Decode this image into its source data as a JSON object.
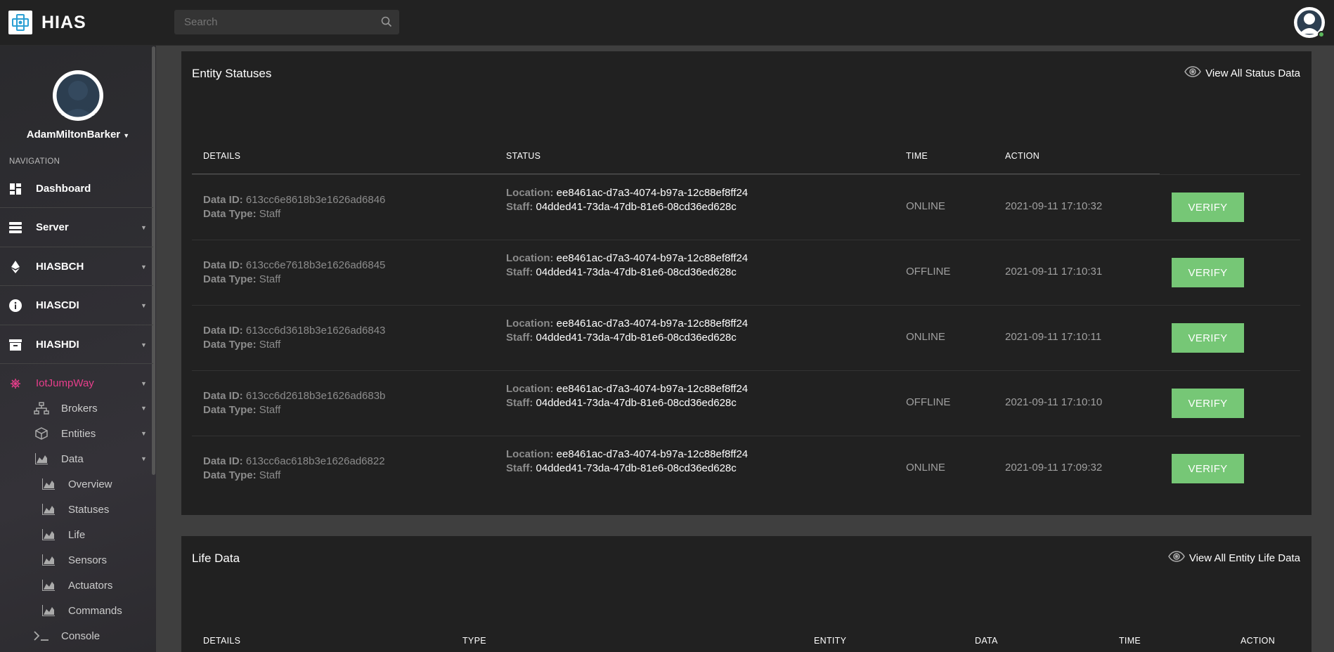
{
  "app": {
    "brand": "HIAS"
  },
  "search": {
    "placeholder": "Search"
  },
  "user": {
    "name": "AdamMiltonBarker"
  },
  "sidebar": {
    "heading": "NAVIGATION",
    "items": [
      {
        "label": "Dashboard",
        "icon": "dashboard-icon"
      },
      {
        "label": "Server",
        "icon": "server-icon"
      },
      {
        "label": "HIASBCH",
        "icon": "ethereum-icon"
      },
      {
        "label": "HIASCDI",
        "icon": "info-icon"
      },
      {
        "label": "HIASHDI",
        "icon": "archive-icon"
      },
      {
        "label": "IotJumpWay",
        "icon": "chip-icon",
        "active_color": "#e83e8c"
      }
    ],
    "sub_items": [
      {
        "label": "Brokers",
        "icon": "sitemap-icon"
      },
      {
        "label": "Entities",
        "icon": "cube-icon"
      },
      {
        "label": "Data",
        "icon": "area-chart-icon"
      }
    ],
    "data_items": [
      {
        "label": "Overview"
      },
      {
        "label": "Statuses"
      },
      {
        "label": "Life"
      },
      {
        "label": "Sensors"
      },
      {
        "label": "Actuators"
      },
      {
        "label": "Commands"
      }
    ],
    "console": {
      "label": "Console",
      "icon": "terminal-icon"
    }
  },
  "statuses": {
    "title": "Entity Statuses",
    "link": "View All Status Data",
    "columns": [
      "DETAILS",
      "STATUS",
      "TIME",
      "ACTION"
    ],
    "labels": {
      "data_id": "Data ID:",
      "data_type": "Data Type:",
      "location": "Location:",
      "staff": "Staff:"
    },
    "rows": [
      {
        "data_id": "613cc6e8618b3e1626ad6846",
        "data_type": "Staff",
        "location": "ee8461ac-d7a3-4074-b97a-12c88ef8ff24",
        "staff": "04dded41-73da-47db-81e6-08cd36ed628c",
        "status": "ONLINE",
        "time": "2021-09-11 17:10:32",
        "action": "VERIFY"
      },
      {
        "data_id": "613cc6e7618b3e1626ad6845",
        "data_type": "Staff",
        "location": "ee8461ac-d7a3-4074-b97a-12c88ef8ff24",
        "staff": "04dded41-73da-47db-81e6-08cd36ed628c",
        "status": "OFFLINE",
        "time": "2021-09-11 17:10:31",
        "action": "VERIFY"
      },
      {
        "data_id": "613cc6d3618b3e1626ad6843",
        "data_type": "Staff",
        "location": "ee8461ac-d7a3-4074-b97a-12c88ef8ff24",
        "staff": "04dded41-73da-47db-81e6-08cd36ed628c",
        "status": "ONLINE",
        "time": "2021-09-11 17:10:11",
        "action": "VERIFY"
      },
      {
        "data_id": "613cc6d2618b3e1626ad683b",
        "data_type": "Staff",
        "location": "ee8461ac-d7a3-4074-b97a-12c88ef8ff24",
        "staff": "04dded41-73da-47db-81e6-08cd36ed628c",
        "status": "OFFLINE",
        "time": "2021-09-11 17:10:10",
        "action": "VERIFY"
      },
      {
        "data_id": "613cc6ac618b3e1626ad6822",
        "data_type": "Staff",
        "location": "ee8461ac-d7a3-4074-b97a-12c88ef8ff24",
        "staff": "04dded41-73da-47db-81e6-08cd36ed628c",
        "status": "ONLINE",
        "time": "2021-09-11 17:09:32",
        "action": "VERIFY"
      }
    ]
  },
  "life": {
    "title": "Life Data",
    "link": "View All Entity Life Data",
    "columns": [
      "DETAILS",
      "TYPE",
      "ENTITY",
      "DATA",
      "TIME",
      "ACTION"
    ]
  },
  "colors": {
    "verify_button": "#76c776",
    "active_nav": "#e83e8c",
    "online_dot": "#5cb85c"
  }
}
